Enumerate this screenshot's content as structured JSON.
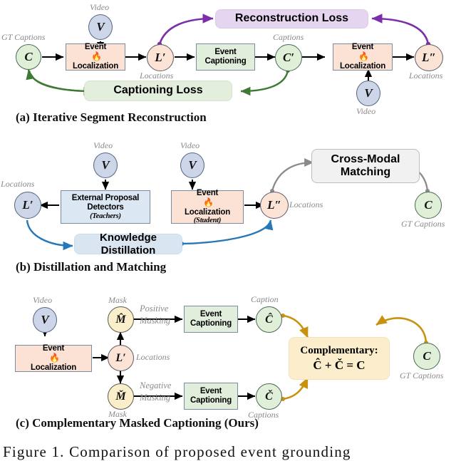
{
  "figure": {
    "caption": "Figure 1.   Comparison of proposed event grounding"
  },
  "colors": {
    "peach": "#fbe2d5",
    "green": "#e2eedc",
    "blue": "#dbe7f3",
    "purple_banner": "#e6d5f0",
    "green_banner": "#e3eedd",
    "blue_banner": "#d9e6f2",
    "gray_banner": "#f1f1f1",
    "cream_banner": "#fceecd",
    "arrow_black": "#000000",
    "arrow_purple": "#7b2fa8",
    "arrow_green": "#3f7a34",
    "arrow_blue": "#2878b8",
    "arrow_gray": "#8a8a8a",
    "arrow_gold": "#c8920f",
    "note_gray": "#8a8a8a"
  },
  "panels": [
    {
      "id": "a",
      "title": "(a) Iterative Segment Reconstruction",
      "nodes": {
        "video_top": "V",
        "video_top_label": "Video",
        "gt_captions": "C",
        "gt_captions_label": "GT Captions",
        "event_localization_1_line1": "Event",
        "event_localization_1_line2": "Localization",
        "l_prime": "L′",
        "l_prime_label": "Locations",
        "event_captioning_line1": "Event",
        "event_captioning_line2": "Captioning",
        "c_prime": "C′",
        "c_prime_label": "Captions",
        "event_localization_2_line1": "Event",
        "event_localization_2_line2": "Localization",
        "video_bottom": "V",
        "video_bottom_label": "Video",
        "l_double_prime": "L″",
        "l_double_prime_label": "Locations",
        "reconstruction_loss": "Reconstruction Loss",
        "captioning_loss": "Captioning Loss"
      }
    },
    {
      "id": "b",
      "title": "(b) Distillation and Matching",
      "nodes": {
        "video_left": "V",
        "video_left_label": "Video",
        "video_right": "V",
        "video_right_label": "Video",
        "external_proposal_line1": "External Proposal",
        "external_proposal_line2": "Detectors",
        "external_proposal_sub": "(Teachers)",
        "event_localization_line1": "Event",
        "event_localization_line2": "Localization",
        "event_localization_sub": "(Student)",
        "l_prime": "L′",
        "l_prime_label": "Locations",
        "l_double_prime": "L″",
        "l_double_prime_label": "Locations",
        "cross_modal_line1": "Cross-Modal",
        "cross_modal_line2": "Matching",
        "gt_captions": "C",
        "gt_captions_label": "GT Captions",
        "knowledge_distillation": "Knowledge Distillation"
      }
    },
    {
      "id": "c",
      "title": "(c) Complementary Masked Captioning (Ours)",
      "nodes": {
        "video": "V",
        "video_label": "Video",
        "event_localization_line1": "Event",
        "event_localization_line2": "Localization",
        "l_prime": "L′",
        "l_prime_label": "Locations",
        "mask_pos": "M̂",
        "mask_pos_label": "Mask",
        "mask_neg": "M̌",
        "mask_neg_label": "Mask",
        "positive_masking_line1": "Positive",
        "positive_masking_line2": "Masking",
        "negative_masking_line1": "Negative",
        "negative_masking_line2": "Masking",
        "event_captioning_top_line1": "Event",
        "event_captioning_top_line2": "Captioning",
        "event_captioning_bottom_line1": "Event",
        "event_captioning_bottom_line2": "Captioning",
        "caption_pos": "Ĉ",
        "caption_pos_label": "Caption",
        "caption_neg": "Č",
        "caption_neg_label": "Captions",
        "complementary_title": "Complementary:",
        "complementary_formula": "Ĉ + Č = C",
        "gt_captions": "C",
        "gt_captions_label": "GT Captions"
      }
    }
  ]
}
